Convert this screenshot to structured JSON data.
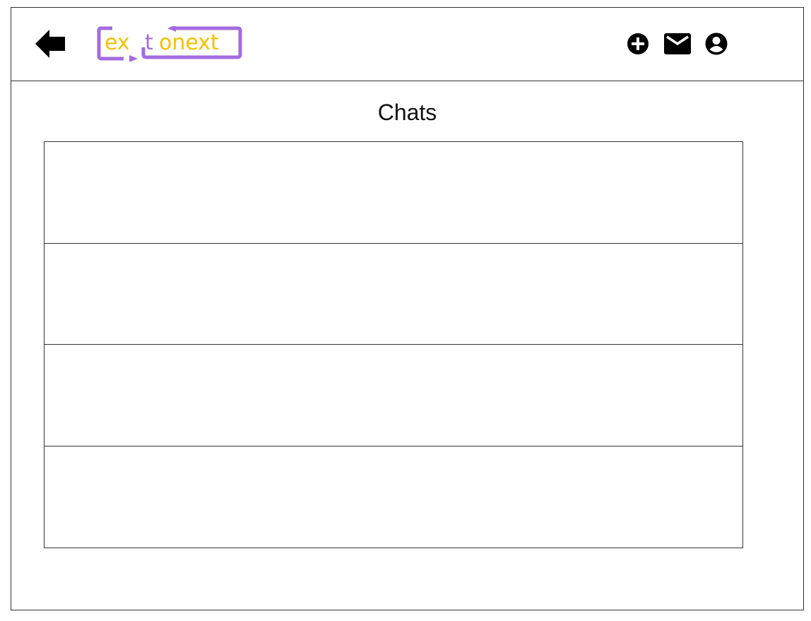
{
  "header": {
    "logo": {
      "text_left": "ex",
      "text_t": "t",
      "text_right": "onext",
      "brand_purple": "#a36be0",
      "brand_yellow": "#f2c100"
    },
    "icons": {
      "back": "back-arrow-icon",
      "add": "plus-circle-icon",
      "mail": "mail-icon",
      "profile": "account-circle-icon"
    }
  },
  "page": {
    "title": "Chats"
  },
  "chats": {
    "items": [
      {
        "label": ""
      },
      {
        "label": ""
      },
      {
        "label": ""
      },
      {
        "label": ""
      }
    ]
  },
  "colors": {
    "border": "#333333",
    "icon": "#000000",
    "background": "#ffffff"
  }
}
